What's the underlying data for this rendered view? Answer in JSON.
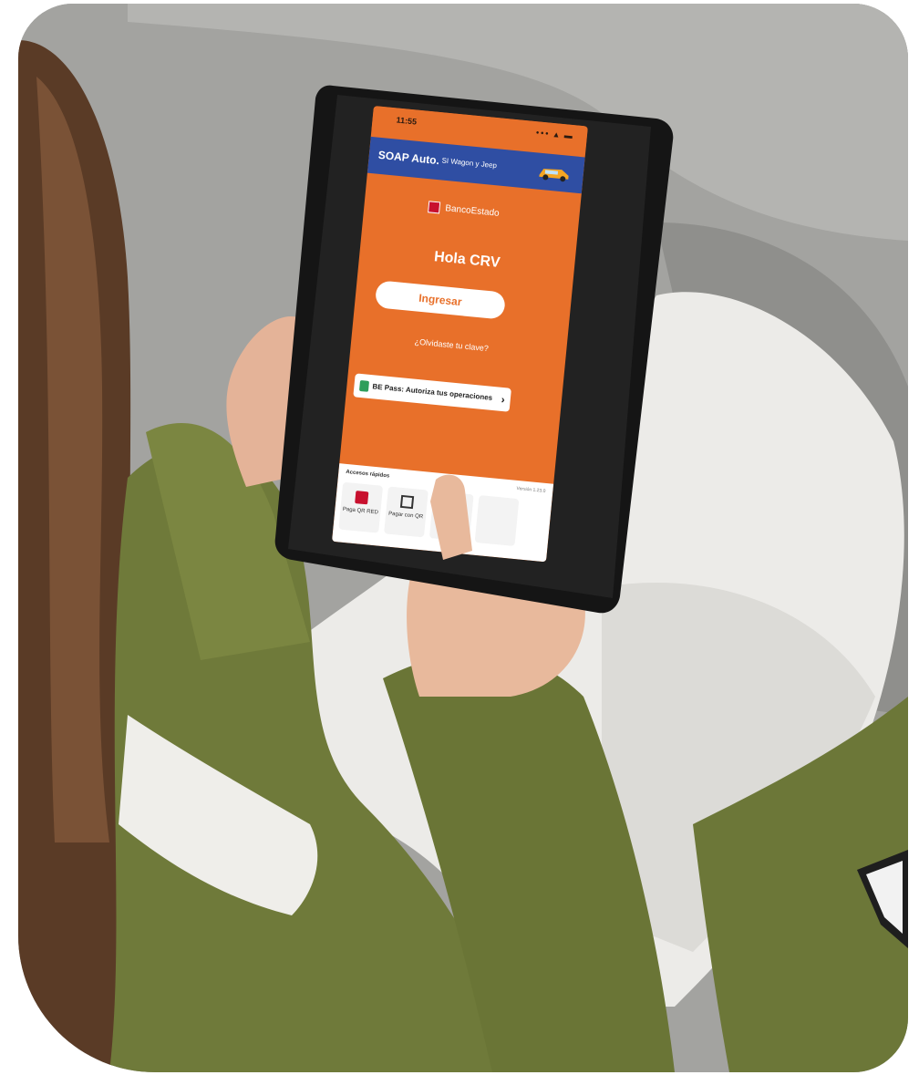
{
  "status_bar": {
    "time": "11:55",
    "icons": "••• ▴ ▬"
  },
  "banner": {
    "title": "SOAP Auto.",
    "subtitle": "SI Wagon y Jeep",
    "background": "#2f4ea3"
  },
  "app": {
    "logo_text": "BancoEstado",
    "greeting": "Hola CRV",
    "login_button": "Ingresar",
    "forgot_link": "¿Olvidaste tu clave?",
    "bepass_button": "BE Pass: Autoriza tus operaciones",
    "bepass_chevron": "›",
    "accent_color": "#e8702a"
  },
  "quick_access": {
    "title": "Accesos rápidos",
    "version": "Versión 1.23.0",
    "tiles": [
      {
        "label": "Paga QR RED",
        "icon": "red-qr-icon"
      },
      {
        "label": "Pagar con QR",
        "icon": "qr-scan-icon"
      }
    ]
  }
}
